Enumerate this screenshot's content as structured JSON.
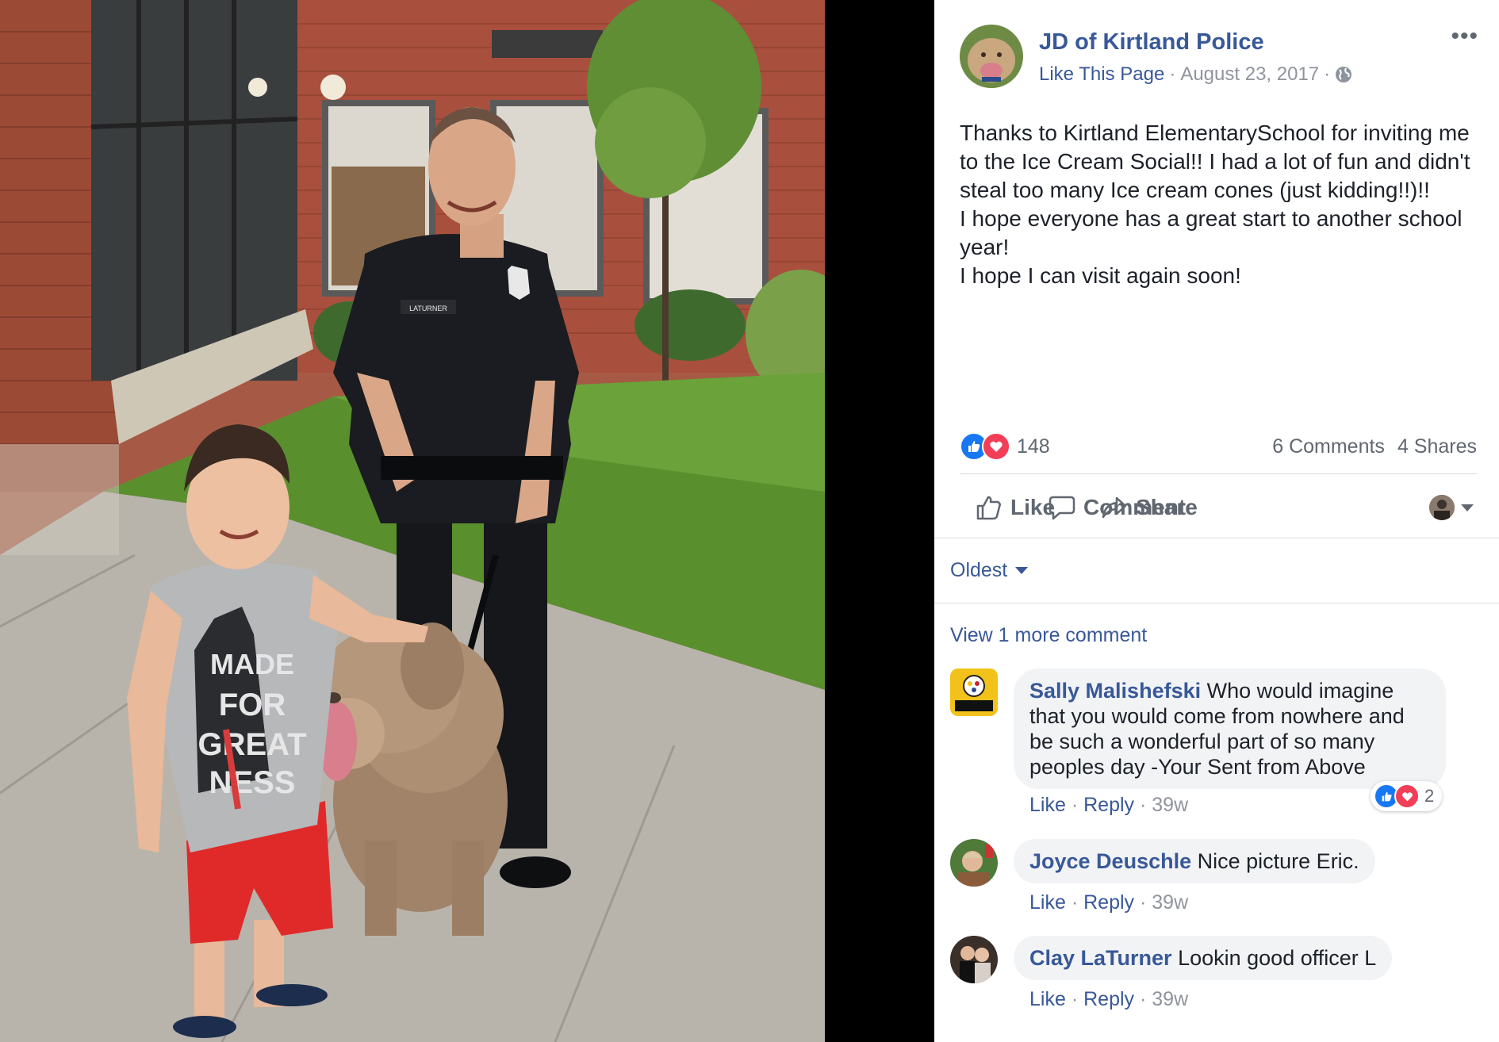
{
  "post": {
    "page_name": "JD of Kirtland Police",
    "like_page": "Like This Page",
    "separator": "·",
    "date": "August 23, 2017",
    "more_label": "•••",
    "text_lines": [
      "Thanks to Kirtland ElementarySchool for inviting me to the Ice Cream Social!! I had a lot of fun and didn't steal too many Ice cream cones (just kidding!!)!!",
      "I hope everyone has a great start to another school year!",
      "I hope I can visit again soon!"
    ],
    "reaction_count": "148",
    "comments_count": "6 Comments",
    "shares_count": "4 Shares"
  },
  "actions": {
    "like": "Like",
    "comment": "Comment",
    "share": "Share"
  },
  "comments_section": {
    "sort_label": "Oldest",
    "view_more": "View 1 more comment",
    "meta_like": "Like",
    "meta_reply": "Reply",
    "meta_dot": "·",
    "items": [
      {
        "name": "Sally Malishefski",
        "text": "Who would imagine that you would come from nowhere and be such a wonderful part of so many peoples day -Your Sent from Above",
        "age": "39w",
        "reactions": "2",
        "avatar_text": "Steelers COUNTRY"
      },
      {
        "name": "Joyce Deuschle",
        "text": "Nice picture Eric.",
        "age": "39w"
      },
      {
        "name": "Clay LaTurner",
        "text": "Lookin good officer L",
        "age": "39w"
      }
    ]
  },
  "photo": {
    "shirt_text": [
      "MADE",
      "FOR",
      "GREAT",
      "NESS"
    ],
    "name_tag": "LATURNER"
  },
  "colors": {
    "link": "#385898",
    "like_blue": "#1877f2",
    "love_red": "#f33e58",
    "secondary": "#606770",
    "bubble": "#f2f3f5"
  }
}
